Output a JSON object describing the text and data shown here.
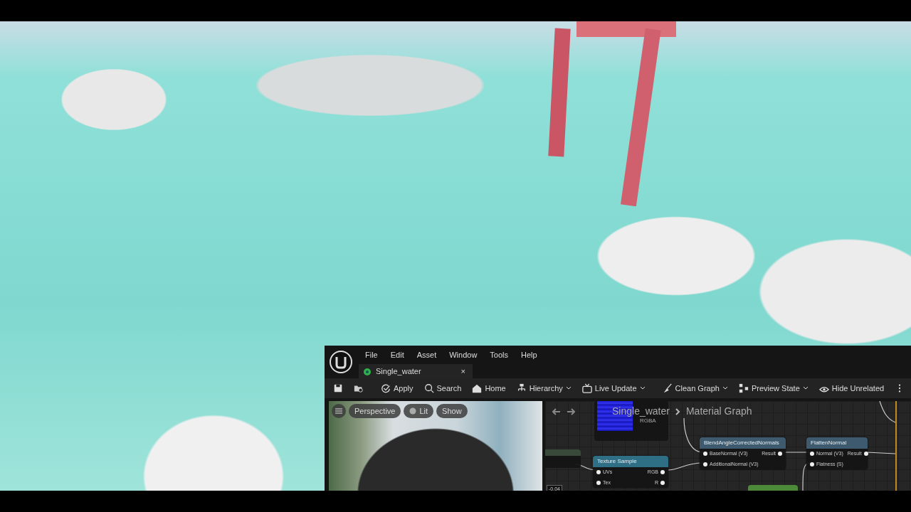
{
  "editor": {
    "menu": [
      "File",
      "Edit",
      "Asset",
      "Window",
      "Tools",
      "Help"
    ],
    "tab": {
      "label": "Single_water",
      "close": "×"
    },
    "toolbar": [
      {
        "kind": "save",
        "dropdown": false
      },
      {
        "kind": "browse",
        "dropdown": false
      },
      {
        "kind": "apply",
        "label": "Apply",
        "dropdown": false
      },
      {
        "kind": "search",
        "label": "Search",
        "dropdown": false
      },
      {
        "kind": "home",
        "label": "Home",
        "dropdown": false
      },
      {
        "kind": "hierarchy",
        "label": "Hierarchy",
        "dropdown": true
      },
      {
        "kind": "live",
        "label": "Live Update",
        "dropdown": true
      },
      {
        "kind": "clean",
        "label": "Clean Graph",
        "dropdown": true
      },
      {
        "kind": "preview",
        "label": "Preview State",
        "dropdown": true
      },
      {
        "kind": "hide",
        "label": "Hide Unrelated",
        "dropdown": false
      },
      {
        "kind": "more",
        "dropdown": false
      }
    ],
    "preview": {
      "buttons": [
        {
          "kind": "menu"
        },
        {
          "kind": "text",
          "label": "Perspective"
        },
        {
          "kind": "lit",
          "label": "Lit"
        },
        {
          "kind": "text",
          "label": "Show"
        }
      ]
    },
    "graph": {
      "breadcrumb": [
        "Single_water",
        "Material Graph"
      ],
      "texture_pin": "RGBA",
      "value": "-0.04",
      "nodes": [
        {
          "title": "Texture Sample",
          "color": "#2f6f86",
          "inputs": [
            "UVs",
            "Tex"
          ],
          "outputs": [
            "RGB",
            "R"
          ]
        },
        {
          "title": "BlendAngleCorrectedNormals",
          "color": "#3d5a6e",
          "inputs": [
            "BaseNormal (V3)",
            "AdditionalNormal (V3)"
          ],
          "outputs": [
            "Result"
          ]
        },
        {
          "title": "FlattenNormal",
          "color": "#3d5a6e",
          "inputs": [
            "Normal (V3)",
            "Flatness (S)"
          ],
          "outputs": [
            "Result"
          ]
        }
      ]
    }
  }
}
